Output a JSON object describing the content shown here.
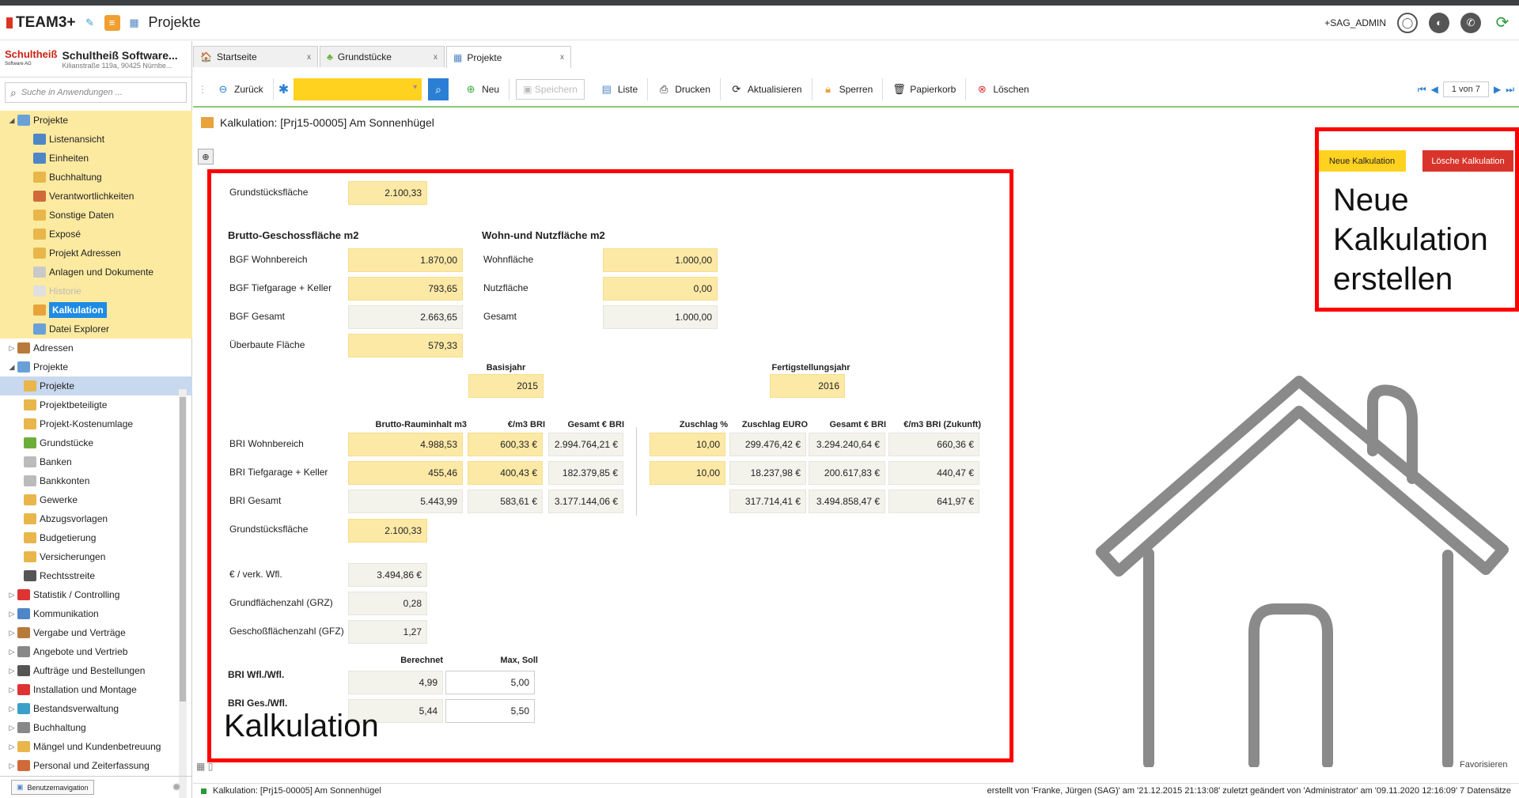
{
  "app": {
    "brand": "TEAM3+",
    "title": "Projekte",
    "user": "+SAG_ADMIN"
  },
  "company": {
    "brand": "Schultheiß",
    "brand_sub": "Software AG",
    "name": "Schultheiß Software...",
    "address": "Kilianstraße 119a, 90425 Nürnbe..."
  },
  "search": {
    "placeholder": "Suche in Anwendungen ..."
  },
  "tree": [
    {
      "label": "Projekte",
      "level": 0,
      "toggle": "◢",
      "style": "yel",
      "icon": "projects-icon",
      "color": "#6aa0d8"
    },
    {
      "label": "Listenansicht",
      "level": 2,
      "style": "yel",
      "icon": "list-icon",
      "color": "#4f86c6"
    },
    {
      "label": "Einheiten",
      "level": 2,
      "style": "yel",
      "icon": "units-icon",
      "color": "#4f86c6"
    },
    {
      "label": "Buchhaltung",
      "level": 2,
      "style": "yel",
      "icon": "folder-icon",
      "color": "#e8b64a"
    },
    {
      "label": "Verantwortlichkeiten",
      "level": 2,
      "style": "yel",
      "icon": "person-icon",
      "color": "#d06a3a"
    },
    {
      "label": "Sonstige Daten",
      "level": 2,
      "style": "yel",
      "icon": "folder-icon",
      "color": "#e8b64a"
    },
    {
      "label": "Exposé",
      "level": 2,
      "style": "yel",
      "icon": "folder-icon",
      "color": "#e8b64a"
    },
    {
      "label": "Projekt Adressen",
      "level": 2,
      "style": "yel",
      "icon": "folder-icon",
      "color": "#e8b64a"
    },
    {
      "label": "Anlagen und Dokumente",
      "level": 2,
      "style": "yel",
      "icon": "document-icon",
      "color": "#c9c9c9"
    },
    {
      "label": "Historie",
      "level": 2,
      "style": "yel dim",
      "icon": "history-icon",
      "color": "#e0e0e0"
    },
    {
      "label": "Kalkulation",
      "level": 2,
      "style": "yel sel",
      "icon": "calculation-icon",
      "color": "#e8a33c"
    },
    {
      "label": "Datei Explorer",
      "level": 2,
      "style": "yel",
      "icon": "folder-icon",
      "color": "#6aa0d8"
    },
    {
      "label": "Adressen",
      "level": 0,
      "toggle": "▷",
      "icon": "address-book-icon",
      "color": "#b87a3a"
    },
    {
      "label": "Projekte",
      "level": 0,
      "toggle": "◢",
      "icon": "projects-icon",
      "color": "#6aa0d8"
    },
    {
      "label": "Projekte",
      "level": 1,
      "style": "sel2",
      "icon": "projects-icon",
      "color": "#e8b64a"
    },
    {
      "label": "Projektbeteiligte",
      "level": 1,
      "icon": "participants-icon",
      "color": "#e8b64a"
    },
    {
      "label": "Projekt-Kostenumlage",
      "level": 1,
      "icon": "folder-icon",
      "color": "#e8b64a"
    },
    {
      "label": "Grundstücke",
      "level": 1,
      "icon": "tree-icon",
      "color": "#6cae3a"
    },
    {
      "label": "Banken",
      "level": 1,
      "icon": "bank-icon",
      "color": "#bbbbbb"
    },
    {
      "label": "Bankkonten",
      "level": 1,
      "icon": "bank-account-icon",
      "color": "#bbbbbb"
    },
    {
      "label": "Gewerke",
      "level": 1,
      "icon": "gear-icon",
      "color": "#e8b64a"
    },
    {
      "label": "Abzugsvorlagen",
      "level": 1,
      "icon": "template-icon",
      "color": "#e8b64a"
    },
    {
      "label": "Budgetierung",
      "level": 1,
      "icon": "budget-icon",
      "color": "#e8b64a"
    },
    {
      "label": "Versicherungen",
      "level": 1,
      "icon": "insurance-icon",
      "color": "#e8b64a"
    },
    {
      "label": "Rechtsstreite",
      "level": 1,
      "icon": "paragraph-icon",
      "color": "#555555"
    },
    {
      "label": "Statistik / Controlling",
      "level": 0,
      "toggle": "▷",
      "icon": "pie-chart-icon",
      "color": "#d33"
    },
    {
      "label": "Kommunikation",
      "level": 0,
      "toggle": "▷",
      "icon": "communication-icon",
      "color": "#4f86c6"
    },
    {
      "label": "Vergabe und Verträge",
      "level": 0,
      "toggle": "▷",
      "icon": "contract-icon",
      "color": "#b87a3a"
    },
    {
      "label": "Angebote und Vertrieb",
      "level": 0,
      "toggle": "▷",
      "icon": "tag-icon",
      "color": "#888888"
    },
    {
      "label": "Aufträge und Bestellungen",
      "level": 0,
      "toggle": "▷",
      "icon": "order-icon",
      "color": "#555555"
    },
    {
      "label": "Installation und Montage",
      "level": 0,
      "toggle": "▷",
      "icon": "calendar-icon",
      "color": "#d33"
    },
    {
      "label": "Bestandsverwaltung",
      "level": 0,
      "toggle": "▷",
      "icon": "globe-icon",
      "color": "#3aa0c8"
    },
    {
      "label": "Buchhaltung",
      "level": 0,
      "toggle": "▷",
      "icon": "accounting-icon",
      "color": "#888888"
    },
    {
      "label": "Mängel und Kundenbetreuung",
      "level": 0,
      "toggle": "▷",
      "icon": "support-icon",
      "color": "#e8b64a"
    },
    {
      "label": "Personal und Zeiterfassung",
      "level": 0,
      "toggle": "▷",
      "icon": "personnel-icon",
      "color": "#d06a3a"
    }
  ],
  "bottomnav": {
    "label": "Benutzernavigation"
  },
  "tabs": [
    {
      "label": "Startseite",
      "icon": "home-icon",
      "glyph": "🏠"
    },
    {
      "label": "Grundstücke",
      "icon": "tree-icon",
      "glyph": "♣"
    },
    {
      "label": "Projekte",
      "icon": "projects-icon",
      "glyph": "▦"
    }
  ],
  "toolbar": {
    "back": "Zurück",
    "new": "Neu",
    "save": "Speichern",
    "list": "Liste",
    "print": "Drucken",
    "refresh": "Aktualisieren",
    "lock": "Sperren",
    "trash": "Papierkorb",
    "delete": "Löschen",
    "pager": "1 von 7"
  },
  "page": {
    "title": "Kalkulation: [Prj15-00005] Am Sonnenhügel"
  },
  "form": {
    "grundstuecksflaeche_label": "Grundstücksfläche",
    "grundstuecksflaeche": "2.100,33",
    "bgf_title": "Brutto-Geschossfläche m2",
    "wnf_title": "Wohn-und Nutzfläche m2",
    "bgf_wohn_label": "BGF Wohnbereich",
    "bgf_wohn": "1.870,00",
    "bgf_tg_label": "BGF Tiefgarage + Keller",
    "bgf_tg": "793,65",
    "bgf_ges_label": "BGF Gesamt",
    "bgf_ges": "2.663,65",
    "ueberbaut_label": "Überbaute Fläche",
    "ueberbaut": "579,33",
    "wohnflaeche_label": "Wohnfläche",
    "wohnflaeche": "1.000,00",
    "nutzflaeche_label": "Nutzfläche",
    "nutzflaeche": "0,00",
    "wnf_ges_label": "Gesamt",
    "wnf_ges": "1.000,00",
    "basisjahr_label": "Basisjahr",
    "basisjahr": "2015",
    "fertig_label": "Fertigstellungsjahr",
    "fertig": "2016",
    "cols": {
      "bri": "Brutto-Rauminhalt m3",
      "em3": "€/m3 BRI",
      "ges": "Gesamt € BRI",
      "zpct": "Zuschlag %",
      "zeur": "Zuschlag EURO",
      "ges2": "Gesamt € BRI",
      "zuk": "€/m3 BRI (Zukunft)"
    },
    "rows": [
      {
        "label": "BRI Wohnbereich",
        "bri": "4.988,53",
        "em3": "600,33 €",
        "ges": "2.994.764,21 €",
        "zpct": "10,00",
        "zeur": "299.476,42 €",
        "ges2": "3.294.240,64 €",
        "zuk": "660,36 €"
      },
      {
        "label": "BRI Tiefgarage + Keller",
        "bri": "455,46",
        "em3": "400,43 €",
        "ges": "182.379,85 €",
        "zpct": "10,00",
        "zeur": "18.237,98 €",
        "ges2": "200.617,83 €",
        "zuk": "440,47 €"
      },
      {
        "label": "BRI Gesamt",
        "bri": "5.443,99",
        "em3": "583,61 €",
        "ges": "3.177.144,06 €",
        "zpct": "",
        "zeur": "317.714,41 €",
        "ges2": "3.494.858,47 €",
        "zuk": "641,97 €"
      }
    ],
    "grund2_label": "Grundstücksfläche",
    "grund2": "2.100,33",
    "verk_label": "€ / verk. Wfl.",
    "verk": "3.494,86 €",
    "grz_label": "Grundflächenzahl (GRZ)",
    "grz": "0,28",
    "gfz_label": "Geschoßflächenzahl (GFZ)",
    "gfz": "1,27",
    "berechnet_label": "Berechnet",
    "maxsoll_label": "Max, Soll",
    "briwfl_label": "BRI Wfl./Wfl.",
    "briwfl_b": "4,99",
    "briwfl_m": "5,00",
    "briges_label": "BRI Ges./Wfl.",
    "briges_b": "5,44",
    "briges_m": "5,50"
  },
  "buttons": {
    "neue": "Neue Kalkulation",
    "loesche": "Lösche Kalkulation"
  },
  "annotations": {
    "right": [
      "Neue",
      "Kalkulation",
      "erstellen"
    ],
    "left": "Kalkulation"
  },
  "favorites": "Favorisieren",
  "status": {
    "left": "Kalkulation: [Prj15-00005] Am Sonnenhügel",
    "right": "erstellt von 'Franke, Jürgen (SAG)' am '21.12.2015 21:13:08' zuletzt geändert von 'Administrator' am '09.11.2020 12:16:09'   7 Datensätze"
  },
  "colors": {
    "accent": "#ffd21f",
    "field": "#fde9a6",
    "danger": "#d9342b",
    "highlight": "#ff0000",
    "nav": "#1e8be6"
  }
}
